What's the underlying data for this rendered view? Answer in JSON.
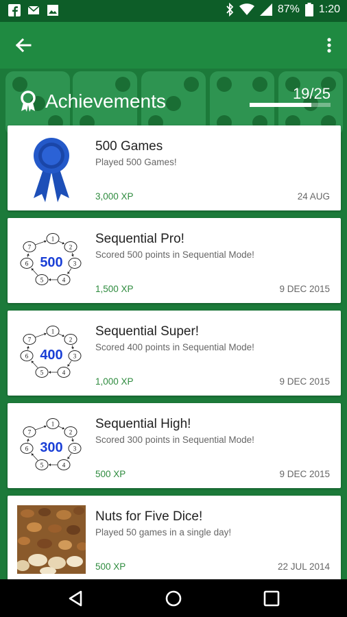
{
  "status_bar": {
    "battery": "87%",
    "time": "1:20",
    "icons": [
      "facebook-icon",
      "mail-icon",
      "image-icon",
      "bluetooth-icon",
      "wifi-icon",
      "signal-icon",
      "battery-icon"
    ]
  },
  "app_bar": {
    "back_icon": "arrow-left-icon",
    "menu_icon": "more-vert-icon"
  },
  "achievements": {
    "title": "Achievements",
    "icon": "award-icon",
    "progress": "19/25",
    "progress_fraction": 0.76
  },
  "cards": [
    {
      "name": "500 Games",
      "desc": "Played 500 Games!",
      "xp": "3,000 XP",
      "date": "24 AUG",
      "thumb": "ribbon"
    },
    {
      "name": "Sequential Pro!",
      "desc": "Scored 500 points in Sequential Mode!",
      "xp": "1,500 XP",
      "date": "9 DEC 2015",
      "thumb": "seq",
      "thumb_label": "500"
    },
    {
      "name": "Sequential Super!",
      "desc": "Scored 400 points in Sequential Mode!",
      "xp": "1,000 XP",
      "date": "9 DEC 2015",
      "thumb": "seq",
      "thumb_label": "400"
    },
    {
      "name": "Sequential High!",
      "desc": "Scored 300 points in Sequential Mode!",
      "xp": "500 XP",
      "date": "9 DEC 2015",
      "thumb": "seq",
      "thumb_label": "300"
    },
    {
      "name": "Nuts for Five Dice!",
      "desc": "Played 50 games in a single day!",
      "xp": "500 XP",
      "date": "22 JUL 2014",
      "thumb": "nuts"
    }
  ],
  "seq_numbers": [
    "1",
    "2",
    "3",
    "4",
    "5",
    "6",
    "7"
  ],
  "nav_bar": {
    "icons": [
      "back-triangle-icon",
      "home-circle-icon",
      "recents-square-icon"
    ]
  },
  "colors": {
    "primary": "#1f8a41",
    "dark": "#0d5d28",
    "xp_green": "#2e8b3e",
    "seq_blue": "#1a3fd6",
    "ribbon_blue": "#1d4fb8"
  }
}
